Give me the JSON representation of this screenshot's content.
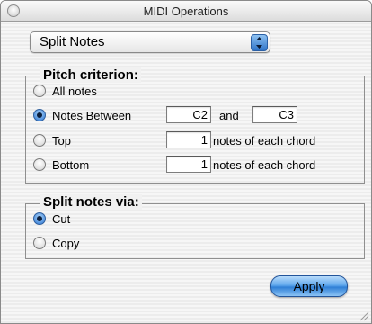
{
  "window": {
    "title": "MIDI Operations"
  },
  "operation_popup": {
    "selected": "Split Notes"
  },
  "pitch_criterion": {
    "title": "Pitch criterion:",
    "options": [
      {
        "label": "All notes",
        "selected": false
      },
      {
        "label": "Notes Between",
        "selected": true
      },
      {
        "label": "Top",
        "selected": false
      },
      {
        "label": "Bottom",
        "selected": false
      }
    ],
    "between": {
      "low": "C2",
      "and_label": "and",
      "high": "C3"
    },
    "top": {
      "count": "1",
      "suffix": "notes of each chord"
    },
    "bottom": {
      "count": "1",
      "suffix": "notes of each chord"
    }
  },
  "split_via": {
    "title": "Split notes via:",
    "options": [
      {
        "label": "Cut",
        "selected": true
      },
      {
        "label": "Copy",
        "selected": false
      }
    ]
  },
  "apply_button": {
    "label": "Apply"
  },
  "icons": {
    "close": "close-icon",
    "popup": "popup-arrows-icon",
    "radio": "radio-button-icon",
    "resize": "resize-grip-icon"
  },
  "colors": {
    "accent": "#2f7fd6"
  }
}
